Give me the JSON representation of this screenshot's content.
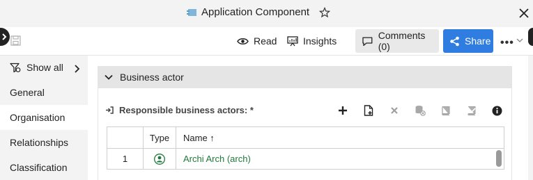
{
  "window": {
    "title": "Application Component"
  },
  "toolbar": {
    "read_label": "Read",
    "insights_label": "Insights",
    "comments_label": "Comments (0)",
    "share_label": "Share",
    "more_label": "•••"
  },
  "sidebar": {
    "show_all_label": "Show all",
    "items": [
      {
        "label": "General",
        "active": false
      },
      {
        "label": "Organisation",
        "active": true
      },
      {
        "label": "Relationships",
        "active": false
      },
      {
        "label": "Classification",
        "active": false
      }
    ]
  },
  "section": {
    "title": "Business actor",
    "field_label": "Responsible business actors: *",
    "tools": [
      "add-icon",
      "new-document-icon",
      "delete-icon",
      "database-remove-icon",
      "book-icon",
      "book-edit-icon",
      "info-icon"
    ]
  },
  "table": {
    "columns": [
      "Type",
      "Name ↑"
    ],
    "rows": [
      {
        "num": "1",
        "type_icon": "person-icon",
        "name": "Archi Arch (arch)"
      }
    ]
  },
  "colors": {
    "accent": "#2f7de1",
    "link": "#1f7a3a",
    "section_header": "#e5e5e5"
  }
}
